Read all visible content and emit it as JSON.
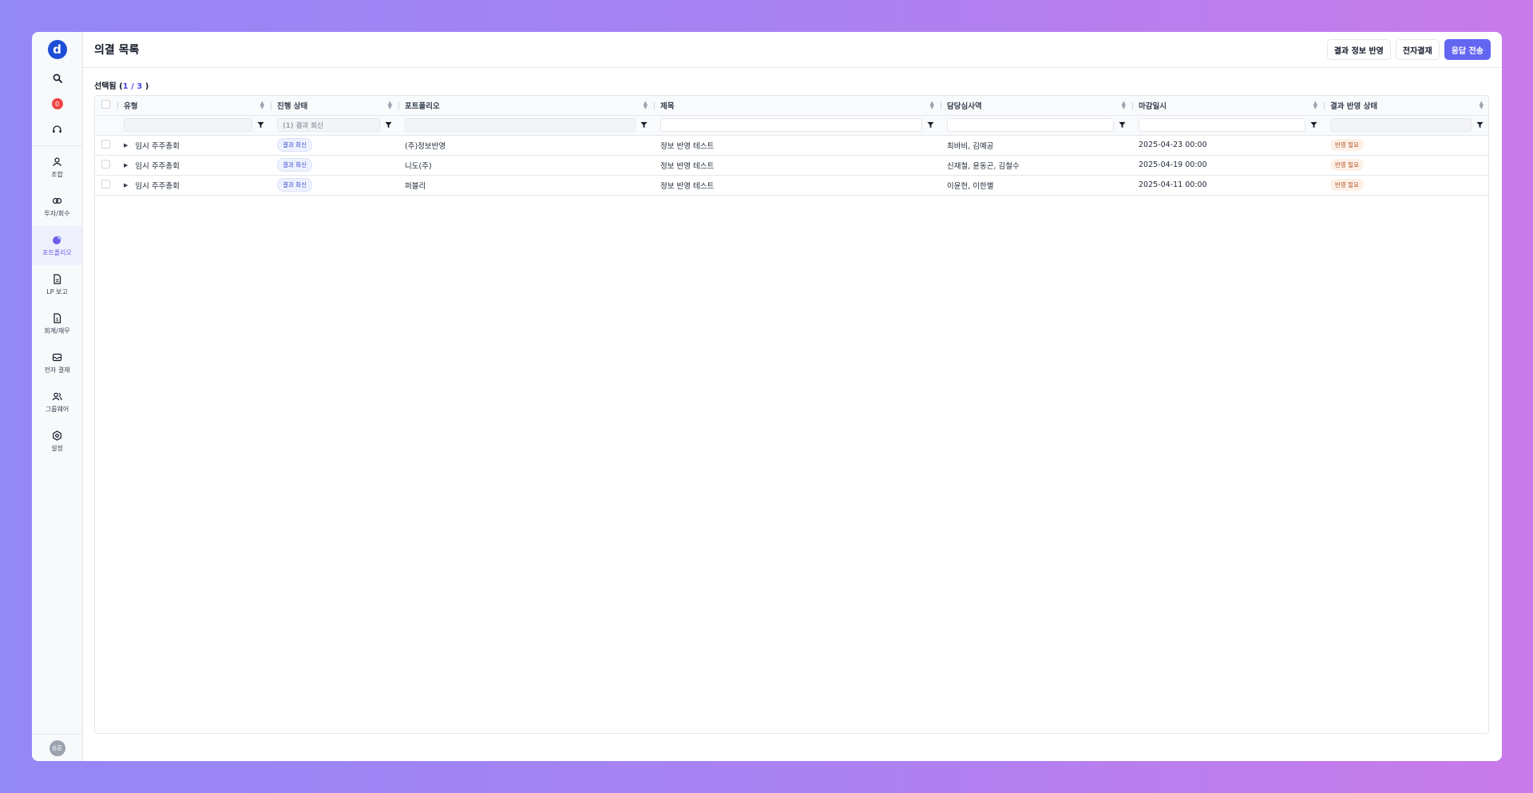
{
  "sidebar": {
    "logo_letter": "d",
    "badge_count": "0",
    "items": [
      {
        "label": "조합",
        "icon": "users-circle-icon"
      },
      {
        "label": "투자/회수",
        "icon": "exchange-icon"
      },
      {
        "label": "포트폴리오",
        "icon": "pie-chart-icon",
        "active": true
      },
      {
        "label": "LP 보고",
        "icon": "document-icon"
      },
      {
        "label": "회계/재무",
        "icon": "ledger-icon"
      },
      {
        "label": "전자 결재",
        "icon": "inbox-icon"
      },
      {
        "label": "그룹웨어",
        "icon": "group-icon"
      },
      {
        "label": "설정",
        "icon": "gear-icon"
      }
    ],
    "avatar_label": "승훈"
  },
  "header": {
    "title": "의결 목록",
    "actions": {
      "reflect_label": "결과 정보 반영",
      "approval_label": "전자결재",
      "send_label": "응답 전송"
    }
  },
  "selection": {
    "prefix": "선택됨 (",
    "selected": "1",
    "separator": " / ",
    "total": "3",
    "suffix": " )"
  },
  "table": {
    "columns": [
      "유형",
      "진행 상태",
      "포트폴리오",
      "제목",
      "담당심사역",
      "마감일시",
      "결과 반영 상태"
    ],
    "filters": {
      "status_placeholder": "(1) 결과 회신"
    },
    "rows": [
      {
        "type": "임시 주주총회",
        "status": "결과 회신",
        "portfolio": "(주)정보반영",
        "title": "정보 반영 테스트",
        "managers": "최바비, 김예공",
        "deadline": "2025-04-23 00:00",
        "reflect_status": "반영 필요"
      },
      {
        "type": "임시 주주총회",
        "status": "결과 회신",
        "portfolio": "니도(주)",
        "title": "정보 반영 테스트",
        "managers": "신재철, 윤동곤, 김철수",
        "deadline": "2025-04-19 00:00",
        "reflect_status": "반영 필요"
      },
      {
        "type": "임시 주주총회",
        "status": "결과 회신",
        "portfolio": "퍼블리",
        "title": "정보 반영 테스트",
        "managers": "이윤헌, 이한별",
        "deadline": "2025-04-11 00:00",
        "reflect_status": "반영 필요"
      }
    ]
  },
  "colors": {
    "primary": "#6366f1",
    "active_nav": "#6d5ce8",
    "badge": "#ef4444",
    "logo": "#1d4ed8"
  }
}
